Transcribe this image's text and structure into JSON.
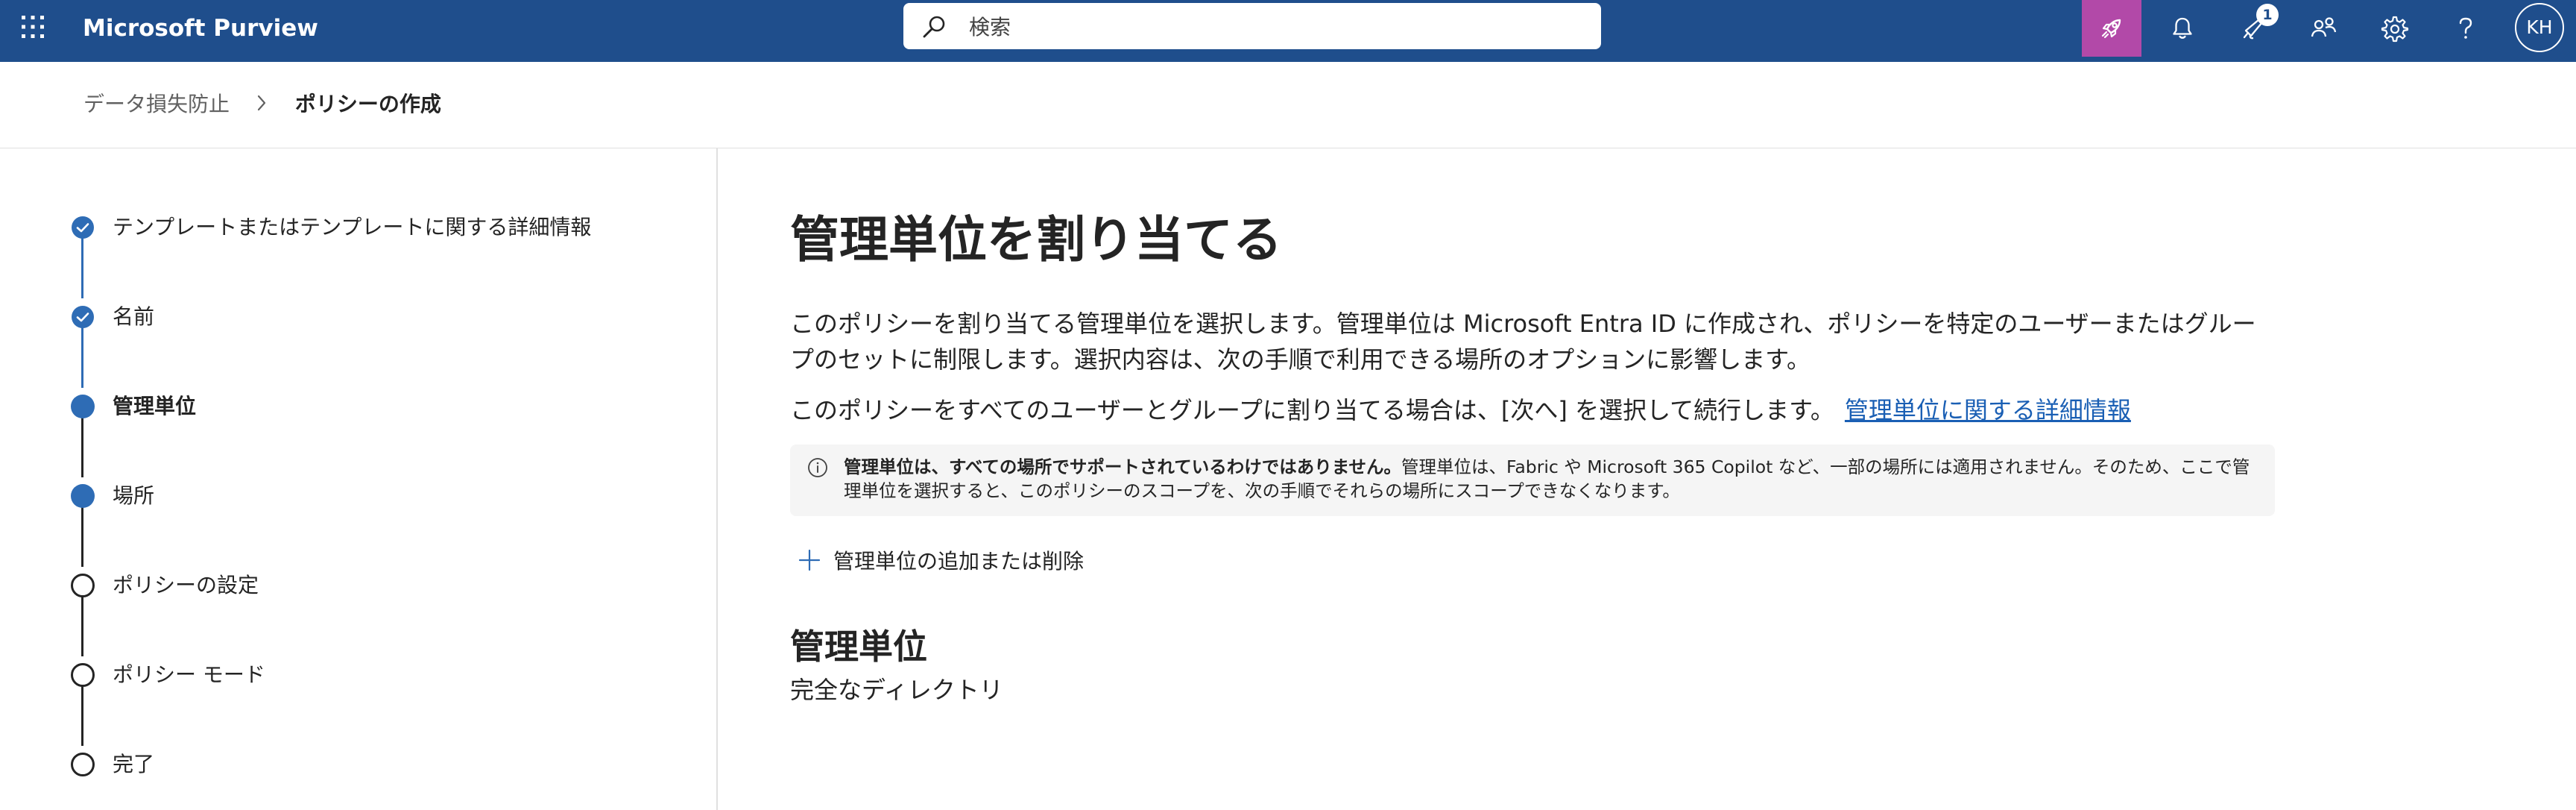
{
  "header": {
    "app_title": "Microsoft Purview",
    "search_placeholder": "検索",
    "notification_count": "1",
    "avatar_initials": "KH",
    "accent_color": "#b249a8",
    "bar_color": "#1f4e8c"
  },
  "breadcrumb": {
    "parent": "データ損失防止",
    "current": "ポリシーの作成"
  },
  "steps": [
    {
      "label": "テンプレートまたはテンプレートに関する詳細情報",
      "state": "completed"
    },
    {
      "label": "名前",
      "state": "completed"
    },
    {
      "label": "管理単位",
      "state": "current"
    },
    {
      "label": "場所",
      "state": "upcoming-active"
    },
    {
      "label": "ポリシーの設定",
      "state": "upcoming"
    },
    {
      "label": "ポリシー モード",
      "state": "upcoming"
    },
    {
      "label": "完了",
      "state": "upcoming"
    }
  ],
  "main": {
    "title": "管理単位を割り当てる",
    "description": "このポリシーを割り当てる管理単位を選択します。管理単位は Microsoft Entra ID に作成され、ポリシーを特定のユーザーまたはグループのセットに制限します。選択内容は、次の手順で利用できる場所のオプションに影響します。",
    "instruction": "このポリシーをすべてのユーザーとグループに割り当てる場合は、[次へ] を選択して続行します。",
    "learn_more_link": "管理単位に関する詳細情報",
    "info_bold": "管理単位は、すべての場所でサポートされているわけではありません。",
    "info_text": "管理単位は、Fabric や Microsoft 365 Copilot など、一部の場所には適用されません。そのため、ここで管理単位を選択すると、このポリシーのスコープを、次の手順でそれらの場所にスコープできなくなります。",
    "add_remove_button": "管理単位の追加または削除",
    "section_title": "管理単位",
    "section_value": "完全なディレクトリ"
  }
}
